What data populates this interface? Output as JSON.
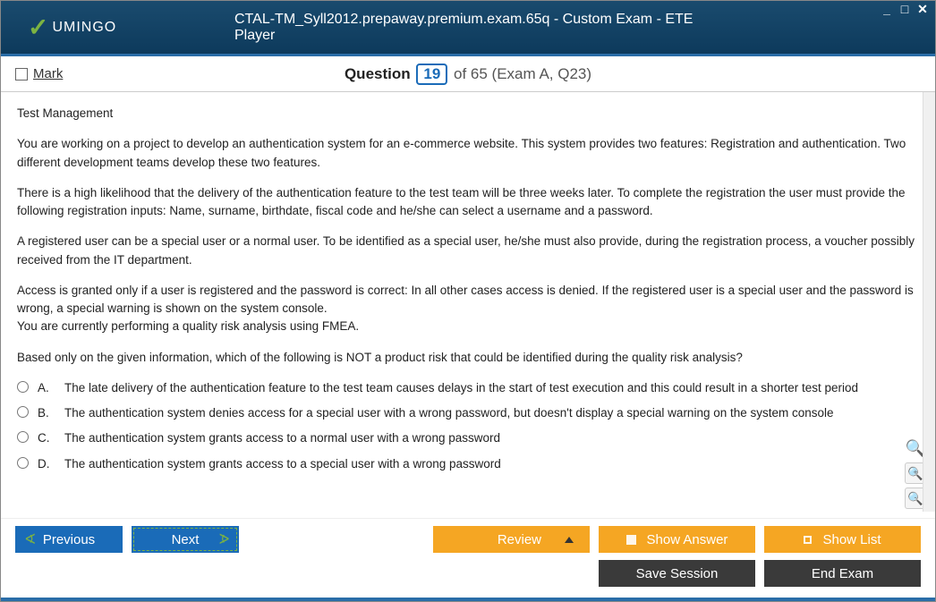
{
  "window": {
    "title": "CTAL-TM_Syll2012.prepaway.premium.exam.65q - Custom Exam - ETE Player",
    "logo_text": "UMINGO"
  },
  "header": {
    "mark_label": "Mark",
    "question_label": "Question",
    "question_number": "19",
    "question_total": " of 65 (Exam A, Q23)"
  },
  "content": {
    "topic": "Test Management",
    "paragraphs": [
      "You are working on a project to develop an authentication system for an e-commerce website. This system provides two features: Registration and authentication. Two different development teams develop these two features.",
      "There is a high likelihood that the delivery of the authentication feature to the test team will be three weeks later. To complete the registration the user must provide the following registration inputs: Name, surname, birthdate, fiscal code and he/she can select a username and a password.",
      "A registered user can be a special user or a normal user. To be identified as a special user, he/she must also provide, during the registration process, a voucher possibly received from the IT department.",
      "Access is granted only if a user is registered and the password is correct: In all other cases access is denied. If the registered user is a special user and the password is wrong,  a special warning is shown on the system console.\nYou are currently performing a quality risk analysis using FMEA.",
      "Based only on the given information, which of the following is NOT a product risk that could be identified during the quality risk analysis?"
    ],
    "options": [
      {
        "letter": "A.",
        "text": "The late delivery of the authentication feature to the test team causes delays in the start of test execution and this could result in a shorter test period"
      },
      {
        "letter": "B.",
        "text": "The authentication system denies access for a special user with a wrong password, but doesn't display a special warning on the system console"
      },
      {
        "letter": "C.",
        "text": "The authentication system grants access to a normal user with a wrong password"
      },
      {
        "letter": "D.",
        "text": "The authentication system grants access to a special user with a wrong password"
      }
    ]
  },
  "footer": {
    "previous": "Previous",
    "next": "Next",
    "review": "Review",
    "show_answer": "Show Answer",
    "show_list": "Show List",
    "save_session": "Save Session",
    "end_exam": "End Exam"
  }
}
